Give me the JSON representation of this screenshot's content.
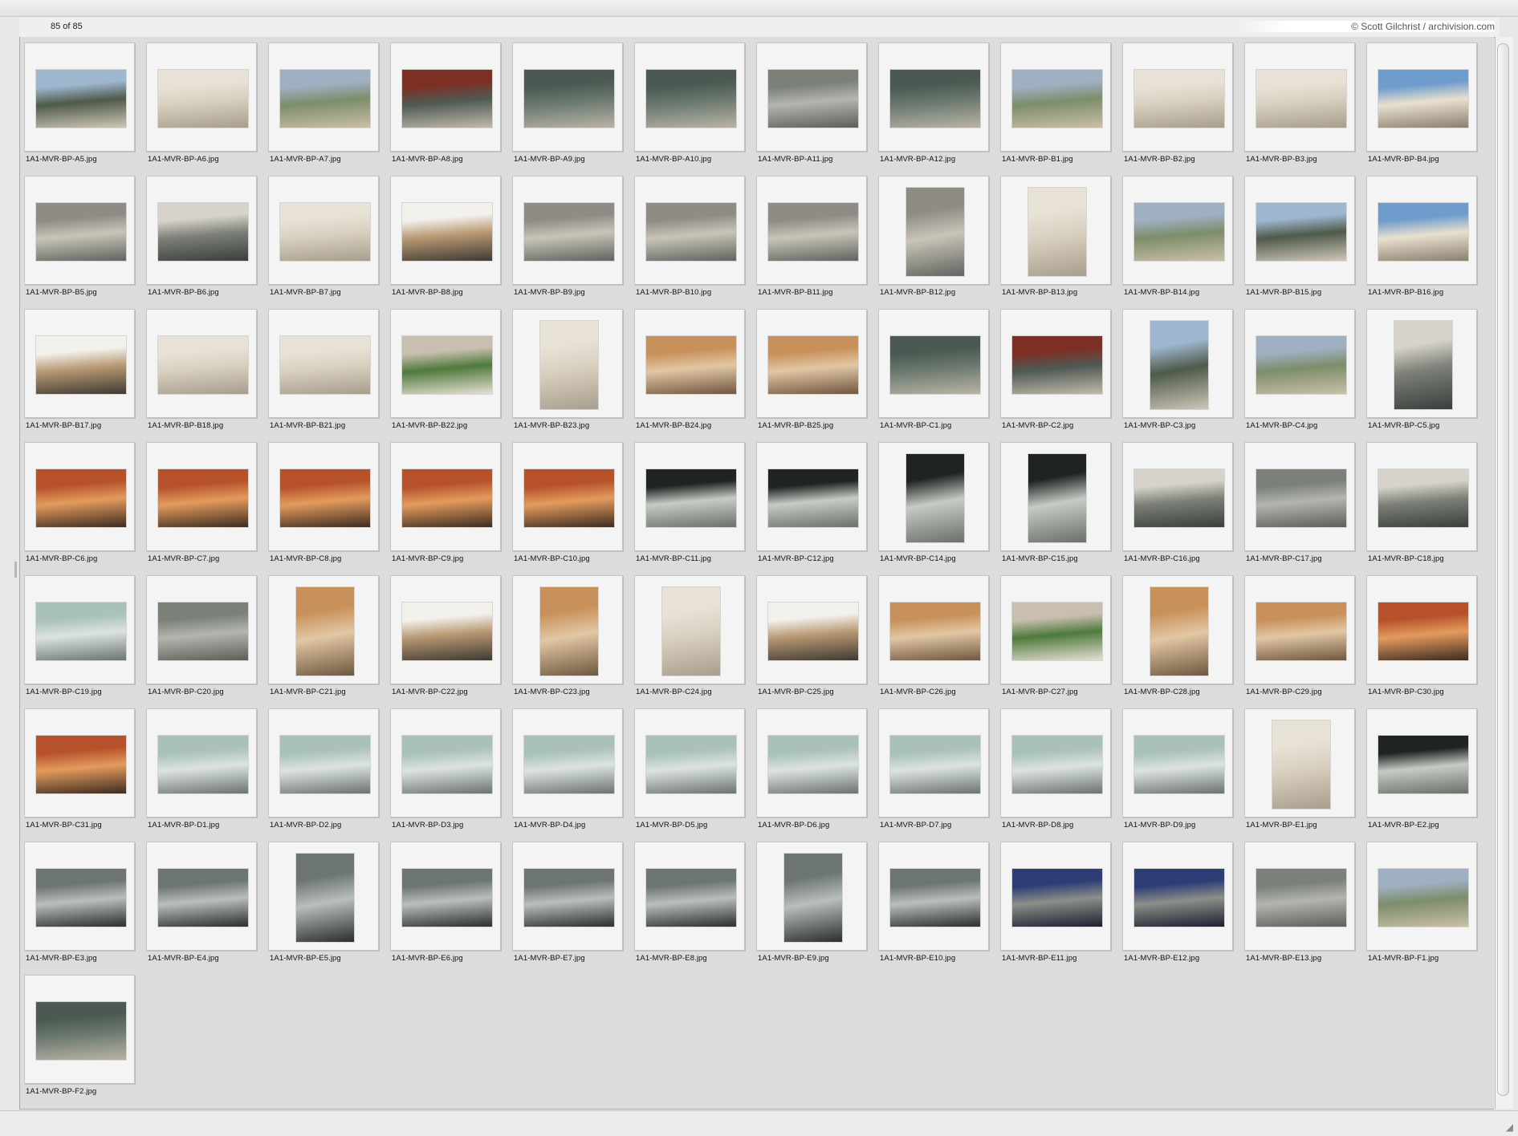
{
  "window": {
    "item_count": "85 of 85",
    "credit": "© Scott Gilchrist / archivision.com",
    "resize_icon": "resize-grip-icon"
  },
  "thumbnails": [
    {
      "name": "1A1-MVR-BP-A5.jpg",
      "orientation": "landscape",
      "palette": "landscape"
    },
    {
      "name": "1A1-MVR-BP-A6.jpg",
      "orientation": "landscape",
      "palette": "travertine"
    },
    {
      "name": "1A1-MVR-BP-A7.jpg",
      "orientation": "landscape",
      "palette": "courtyard"
    },
    {
      "name": "1A1-MVR-BP-A8.jpg",
      "orientation": "landscape",
      "palette": "marble-red"
    },
    {
      "name": "1A1-MVR-BP-A9.jpg",
      "orientation": "landscape",
      "palette": "marble-green"
    },
    {
      "name": "1A1-MVR-BP-A10.jpg",
      "orientation": "landscape",
      "palette": "marble-green"
    },
    {
      "name": "1A1-MVR-BP-A11.jpg",
      "orientation": "landscape",
      "palette": "marble-grey"
    },
    {
      "name": "1A1-MVR-BP-A12.jpg",
      "orientation": "landscape",
      "palette": "marble-green"
    },
    {
      "name": "1A1-MVR-BP-B1.jpg",
      "orientation": "landscape",
      "palette": "courtyard"
    },
    {
      "name": "1A1-MVR-BP-B2.jpg",
      "orientation": "landscape",
      "palette": "travertine"
    },
    {
      "name": "1A1-MVR-BP-B3.jpg",
      "orientation": "landscape",
      "palette": "travertine"
    },
    {
      "name": "1A1-MVR-BP-B4.jpg",
      "orientation": "landscape",
      "palette": "sky"
    },
    {
      "name": "1A1-MVR-BP-B5.jpg",
      "orientation": "landscape",
      "palette": "pool"
    },
    {
      "name": "1A1-MVR-BP-B6.jpg",
      "orientation": "landscape",
      "palette": "interior"
    },
    {
      "name": "1A1-MVR-BP-B7.jpg",
      "orientation": "landscape",
      "palette": "travertine"
    },
    {
      "name": "1A1-MVR-BP-B8.jpg",
      "orientation": "landscape",
      "palette": "canopy"
    },
    {
      "name": "1A1-MVR-BP-B9.jpg",
      "orientation": "landscape",
      "palette": "pool"
    },
    {
      "name": "1A1-MVR-BP-B10.jpg",
      "orientation": "landscape",
      "palette": "pool"
    },
    {
      "name": "1A1-MVR-BP-B11.jpg",
      "orientation": "landscape",
      "palette": "pool"
    },
    {
      "name": "1A1-MVR-BP-B12.jpg",
      "orientation": "portrait",
      "palette": "pool"
    },
    {
      "name": "1A1-MVR-BP-B13.jpg",
      "orientation": "portrait",
      "palette": "travertine"
    },
    {
      "name": "1A1-MVR-BP-B14.jpg",
      "orientation": "landscape",
      "palette": "courtyard"
    },
    {
      "name": "1A1-MVR-BP-B15.jpg",
      "orientation": "landscape",
      "palette": "landscape"
    },
    {
      "name": "1A1-MVR-BP-B16.jpg",
      "orientation": "landscape",
      "palette": "sky"
    },
    {
      "name": "1A1-MVR-BP-B17.jpg",
      "orientation": "landscape",
      "palette": "canopy"
    },
    {
      "name": "1A1-MVR-BP-B18.jpg",
      "orientation": "landscape",
      "palette": "travertine"
    },
    {
      "name": "1A1-MVR-BP-B21.jpg",
      "orientation": "landscape",
      "palette": "travertine"
    },
    {
      "name": "1A1-MVR-BP-B22.jpg",
      "orientation": "landscape",
      "palette": "garden"
    },
    {
      "name": "1A1-MVR-BP-B23.jpg",
      "orientation": "portrait",
      "palette": "travertine"
    },
    {
      "name": "1A1-MVR-BP-B24.jpg",
      "orientation": "landscape",
      "palette": "warm"
    },
    {
      "name": "1A1-MVR-BP-B25.jpg",
      "orientation": "landscape",
      "palette": "warm"
    },
    {
      "name": "1A1-MVR-BP-C1.jpg",
      "orientation": "landscape",
      "palette": "marble-green"
    },
    {
      "name": "1A1-MVR-BP-C2.jpg",
      "orientation": "landscape",
      "palette": "marble-red"
    },
    {
      "name": "1A1-MVR-BP-C3.jpg",
      "orientation": "portrait",
      "palette": "landscape"
    },
    {
      "name": "1A1-MVR-BP-C4.jpg",
      "orientation": "landscape",
      "palette": "courtyard"
    },
    {
      "name": "1A1-MVR-BP-C5.jpg",
      "orientation": "portrait",
      "palette": "interior"
    },
    {
      "name": "1A1-MVR-BP-C6.jpg",
      "orientation": "landscape",
      "palette": "onyx"
    },
    {
      "name": "1A1-MVR-BP-C7.jpg",
      "orientation": "landscape",
      "palette": "onyx"
    },
    {
      "name": "1A1-MVR-BP-C8.jpg",
      "orientation": "landscape",
      "palette": "onyx"
    },
    {
      "name": "1A1-MVR-BP-C9.jpg",
      "orientation": "landscape",
      "palette": "onyx"
    },
    {
      "name": "1A1-MVR-BP-C10.jpg",
      "orientation": "landscape",
      "palette": "onyx"
    },
    {
      "name": "1A1-MVR-BP-C11.jpg",
      "orientation": "landscape",
      "palette": "dark-glass"
    },
    {
      "name": "1A1-MVR-BP-C12.jpg",
      "orientation": "landscape",
      "palette": "dark-glass"
    },
    {
      "name": "1A1-MVR-BP-C14.jpg",
      "orientation": "portrait",
      "palette": "dark-glass"
    },
    {
      "name": "1A1-MVR-BP-C15.jpg",
      "orientation": "portrait",
      "palette": "dark-glass"
    },
    {
      "name": "1A1-MVR-BP-C16.jpg",
      "orientation": "landscape",
      "palette": "interior"
    },
    {
      "name": "1A1-MVR-BP-C17.jpg",
      "orientation": "landscape",
      "palette": "marble-grey"
    },
    {
      "name": "1A1-MVR-BP-C18.jpg",
      "orientation": "landscape",
      "palette": "interior"
    },
    {
      "name": "1A1-MVR-BP-C19.jpg",
      "orientation": "landscape",
      "palette": "glass"
    },
    {
      "name": "1A1-MVR-BP-C20.jpg",
      "orientation": "landscape",
      "palette": "marble-grey"
    },
    {
      "name": "1A1-MVR-BP-C21.jpg",
      "orientation": "portrait",
      "palette": "warm"
    },
    {
      "name": "1A1-MVR-BP-C22.jpg",
      "orientation": "landscape",
      "palette": "canopy"
    },
    {
      "name": "1A1-MVR-BP-C23.jpg",
      "orientation": "portrait",
      "palette": "warm"
    },
    {
      "name": "1A1-MVR-BP-C24.jpg",
      "orientation": "portrait",
      "palette": "travertine"
    },
    {
      "name": "1A1-MVR-BP-C25.jpg",
      "orientation": "landscape",
      "palette": "canopy"
    },
    {
      "name": "1A1-MVR-BP-C26.jpg",
      "orientation": "landscape",
      "palette": "warm"
    },
    {
      "name": "1A1-MVR-BP-C27.jpg",
      "orientation": "landscape",
      "palette": "garden"
    },
    {
      "name": "1A1-MVR-BP-C28.jpg",
      "orientation": "portrait",
      "palette": "warm"
    },
    {
      "name": "1A1-MVR-BP-C29.jpg",
      "orientation": "landscape",
      "palette": "warm"
    },
    {
      "name": "1A1-MVR-BP-C30.jpg",
      "orientation": "landscape",
      "palette": "onyx"
    },
    {
      "name": "1A1-MVR-BP-C31.jpg",
      "orientation": "landscape",
      "palette": "onyx"
    },
    {
      "name": "1A1-MVR-BP-D1.jpg",
      "orientation": "landscape",
      "palette": "glass"
    },
    {
      "name": "1A1-MVR-BP-D2.jpg",
      "orientation": "landscape",
      "palette": "glass"
    },
    {
      "name": "1A1-MVR-BP-D3.jpg",
      "orientation": "landscape",
      "palette": "glass"
    },
    {
      "name": "1A1-MVR-BP-D4.jpg",
      "orientation": "landscape",
      "palette": "glass"
    },
    {
      "name": "1A1-MVR-BP-D5.jpg",
      "orientation": "landscape",
      "palette": "glass"
    },
    {
      "name": "1A1-MVR-BP-D6.jpg",
      "orientation": "landscape",
      "palette": "glass"
    },
    {
      "name": "1A1-MVR-BP-D7.jpg",
      "orientation": "landscape",
      "palette": "glass"
    },
    {
      "name": "1A1-MVR-BP-D8.jpg",
      "orientation": "landscape",
      "palette": "glass"
    },
    {
      "name": "1A1-MVR-BP-D9.jpg",
      "orientation": "landscape",
      "palette": "glass"
    },
    {
      "name": "1A1-MVR-BP-E1.jpg",
      "orientation": "portrait",
      "palette": "travertine"
    },
    {
      "name": "1A1-MVR-BP-E2.jpg",
      "orientation": "landscape",
      "palette": "dark-glass"
    },
    {
      "name": "1A1-MVR-BP-E3.jpg",
      "orientation": "landscape",
      "palette": "statue"
    },
    {
      "name": "1A1-MVR-BP-E4.jpg",
      "orientation": "landscape",
      "palette": "statue"
    },
    {
      "name": "1A1-MVR-BP-E5.jpg",
      "orientation": "portrait",
      "palette": "statue"
    },
    {
      "name": "1A1-MVR-BP-E6.jpg",
      "orientation": "landscape",
      "palette": "statue"
    },
    {
      "name": "1A1-MVR-BP-E7.jpg",
      "orientation": "landscape",
      "palette": "statue"
    },
    {
      "name": "1A1-MVR-BP-E8.jpg",
      "orientation": "landscape",
      "palette": "statue"
    },
    {
      "name": "1A1-MVR-BP-E9.jpg",
      "orientation": "portrait",
      "palette": "statue"
    },
    {
      "name": "1A1-MVR-BP-E10.jpg",
      "orientation": "landscape",
      "palette": "statue"
    },
    {
      "name": "1A1-MVR-BP-E11.jpg",
      "orientation": "landscape",
      "palette": "reflection"
    },
    {
      "name": "1A1-MVR-BP-E12.jpg",
      "orientation": "landscape",
      "palette": "reflection"
    },
    {
      "name": "1A1-MVR-BP-E13.jpg",
      "orientation": "landscape",
      "palette": "marble-grey"
    },
    {
      "name": "1A1-MVR-BP-F1.jpg",
      "orientation": "landscape",
      "palette": "courtyard"
    },
    {
      "name": "1A1-MVR-BP-F2.jpg",
      "orientation": "landscape",
      "palette": "marble-green"
    }
  ],
  "palettes": {
    "landscape": [
      "#9fb6cf",
      "#4e5a4a",
      "#cfc7b7"
    ],
    "travertine": [
      "#e8e2d6",
      "#d8cfbf",
      "#a79e8e"
    ],
    "courtyard": [
      "#9fb0c2",
      "#7d8d6a",
      "#c9bfa9"
    ],
    "marble-red": [
      "#7d2f24",
      "#4f5a55",
      "#c2baab"
    ],
    "marble-green": [
      "#4c5952",
      "#6a786f",
      "#b9b3a6"
    ],
    "marble-grey": [
      "#7b8078",
      "#b3b6ae",
      "#5b5f58"
    ],
    "sky": [
      "#6d9ccd",
      "#e9e0cf",
      "#8a7f70"
    ],
    "pool": [
      "#8f8c86",
      "#c9c4b7",
      "#5f6560"
    ],
    "interior": [
      "#d7d3ca",
      "#7c8078",
      "#3a3f3c"
    ],
    "canopy": [
      "#f3f1ec",
      "#b89974",
      "#403a33"
    ],
    "garden": [
      "#c9bfb0",
      "#4f7a3c",
      "#e5dfd3"
    ],
    "warm": [
      "#c8905a",
      "#e2c7a4",
      "#6f5740"
    ],
    "onyx": [
      "#b6512b",
      "#e39b5d",
      "#3d2b20"
    ],
    "dark-glass": [
      "#1f2422",
      "#c6cbc5",
      "#6a7169"
    ],
    "glass": [
      "#a9c0bb",
      "#dce3df",
      "#6b7470"
    ],
    "statue": [
      "#6d7571",
      "#b9bfba",
      "#2a2e2c"
    ],
    "reflection": [
      "#2d3d75",
      "#8c8f8a",
      "#1b2030"
    ]
  }
}
